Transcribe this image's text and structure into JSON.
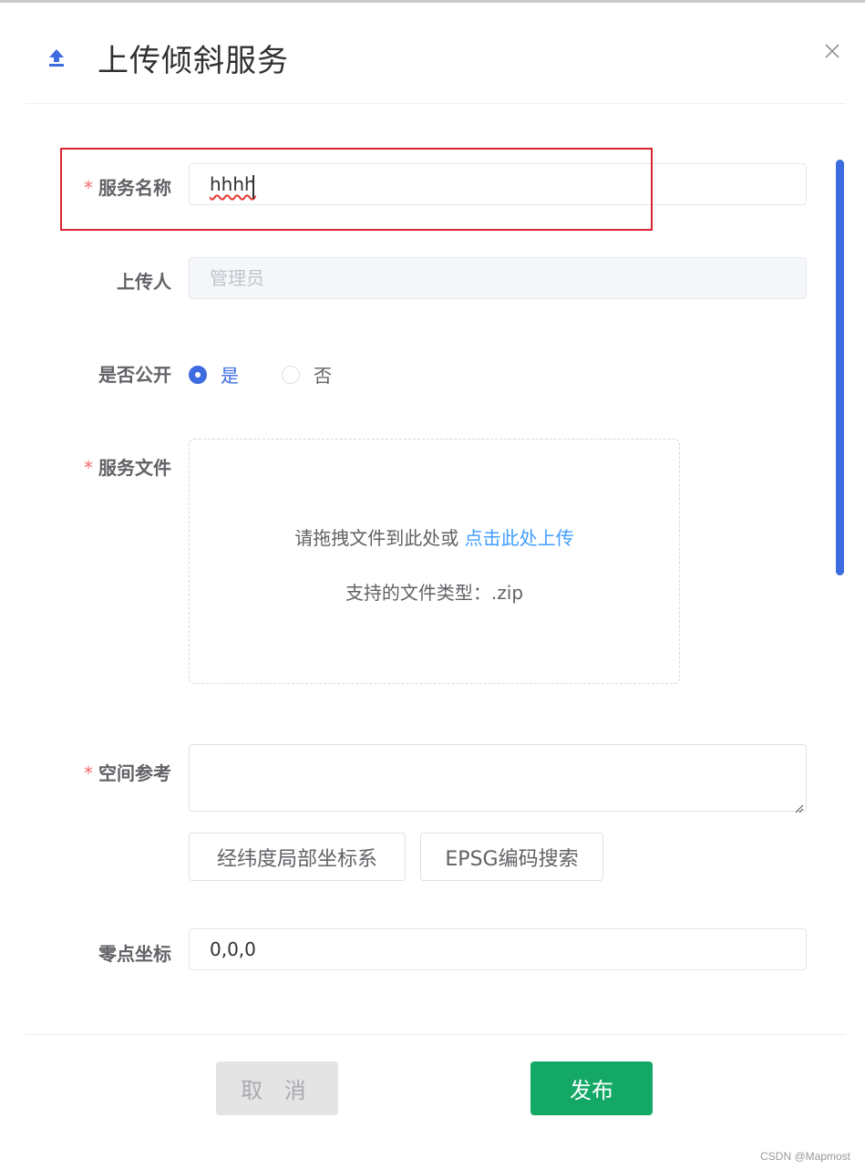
{
  "dialog": {
    "title": "上传倾斜服务",
    "header_icon": "upload-icon",
    "close_icon": "close-icon"
  },
  "form": {
    "required_mark": "*",
    "service_name": {
      "label": "服务名称",
      "value": "hhhh"
    },
    "uploader": {
      "label": "上传人",
      "placeholder": "管理员"
    },
    "is_public": {
      "label": "是否公开",
      "options": [
        {
          "label": "是",
          "checked": true
        },
        {
          "label": "否",
          "checked": false
        }
      ]
    },
    "service_file": {
      "label": "服务文件",
      "drop_text": "请拖拽文件到此处或 ",
      "click_text": "点击此处上传",
      "types_text": "支持的文件类型：.zip"
    },
    "spatial_ref": {
      "label": "空间参考",
      "value": "",
      "buttons": [
        "经纬度局部坐标系",
        "EPSG编码搜索"
      ]
    },
    "origin": {
      "label": "零点坐标",
      "value": "0,0,0"
    }
  },
  "footer": {
    "cancel_label": "取 消",
    "publish_label": "发布"
  },
  "colors": {
    "accent": "#3d6be0",
    "link": "#409eff",
    "publish": "#13a866",
    "required": "#f56c6c",
    "highlight_box": "#d9242f"
  },
  "watermark": "CSDN @Mapmost"
}
